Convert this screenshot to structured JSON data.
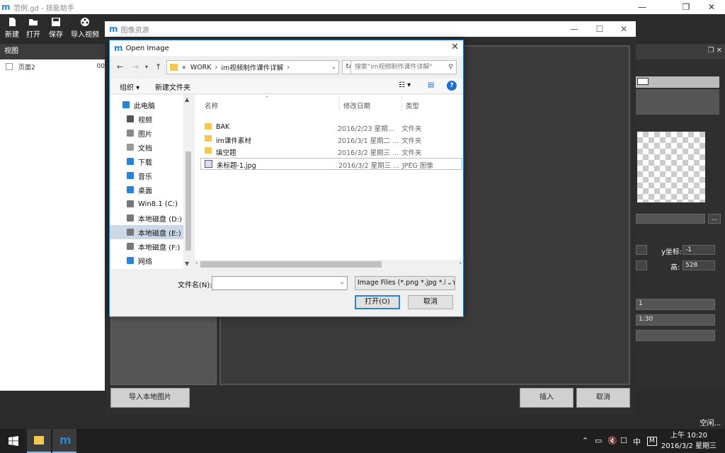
{
  "app": {
    "title": "范例.gd - 技能助手",
    "toolbar": [
      {
        "label": "新建",
        "icon": "new-file-icon"
      },
      {
        "label": "打开",
        "icon": "open-folder-icon"
      },
      {
        "label": "保存",
        "icon": "save-icon"
      },
      {
        "label": "导入视频",
        "icon": "film-reel-icon"
      }
    ],
    "left_panel": {
      "header": "视图",
      "rows": [
        {
          "label": "页面2",
          "num": "00"
        }
      ]
    },
    "status": "空闲..."
  },
  "resource_dialog": {
    "title": "图像资源",
    "import_button": "导入本地图片",
    "insert_button": "插入",
    "cancel_button": "取消"
  },
  "right_panel": {
    "y_label": "y坐标:",
    "y_value": "-1",
    "h_label": "高:",
    "h_value": "528",
    "field1": "1",
    "field2": "1:30",
    "ellipsis": "..."
  },
  "open_dialog": {
    "title": "Open Image",
    "path": {
      "prefix": "«",
      "parts": [
        "WORK",
        "im视频制作课件详解"
      ]
    },
    "search_placeholder": "搜索\"im视频制作课件详解\"",
    "commands": {
      "organize": "组织 ▾",
      "new_folder": "新建文件夹",
      "view": "☷ ▾"
    },
    "tree": [
      {
        "label": "此电脑",
        "icon": "computer-icon",
        "color": "#2a84d6"
      },
      {
        "label": "视频",
        "icon": "video-icon",
        "color": "#555"
      },
      {
        "label": "图片",
        "icon": "pictures-icon",
        "color": "#888"
      },
      {
        "label": "文档",
        "icon": "documents-icon",
        "color": "#999"
      },
      {
        "label": "下载",
        "icon": "download-icon",
        "color": "#2a84d6"
      },
      {
        "label": "音乐",
        "icon": "music-icon",
        "color": "#2a84d6"
      },
      {
        "label": "桌面",
        "icon": "desktop-icon",
        "color": "#2a84d6"
      },
      {
        "label": "Win8.1 (C:)",
        "icon": "drive-icon",
        "color": "#777"
      },
      {
        "label": "本地磁盘 (D:)",
        "icon": "drive-icon",
        "color": "#777"
      },
      {
        "label": "本地磁盘 (E:)",
        "icon": "drive-icon",
        "color": "#777"
      },
      {
        "label": "本地磁盘 (F:)",
        "icon": "drive-icon",
        "color": "#777"
      },
      {
        "label": "网络",
        "icon": "network-icon",
        "color": "#2a84d6"
      }
    ],
    "columns": {
      "name": "名称",
      "date": "修改日期",
      "type": "类型"
    },
    "files": [
      {
        "name": "BAK",
        "date": "2016/2/23 星期...",
        "type": "文件夹",
        "kind": "folder"
      },
      {
        "name": "im课件素材",
        "date": "2016/3/1 星期二 ...",
        "type": "文件夹",
        "kind": "folder"
      },
      {
        "name": "填空题",
        "date": "2016/3/2 星期三 ...",
        "type": "文件夹",
        "kind": "folder"
      },
      {
        "name": "未标题-1.jpg",
        "date": "2016/3/2 星期三 ...",
        "type": "JPEG 图像",
        "kind": "image"
      }
    ],
    "filename_label": "文件名(N):",
    "filename_value": "",
    "filetype": "Image Files (*.png *.jpg *.bmp",
    "open_button": "打开(O)",
    "cancel_button": "取消"
  },
  "taskbar": {
    "ime": "中",
    "ime2": "M",
    "time": "上午 10:20",
    "date": "2016/3/2 星期三"
  },
  "colors": {
    "accent": "#2a84d6",
    "folder": "#f4c951"
  }
}
